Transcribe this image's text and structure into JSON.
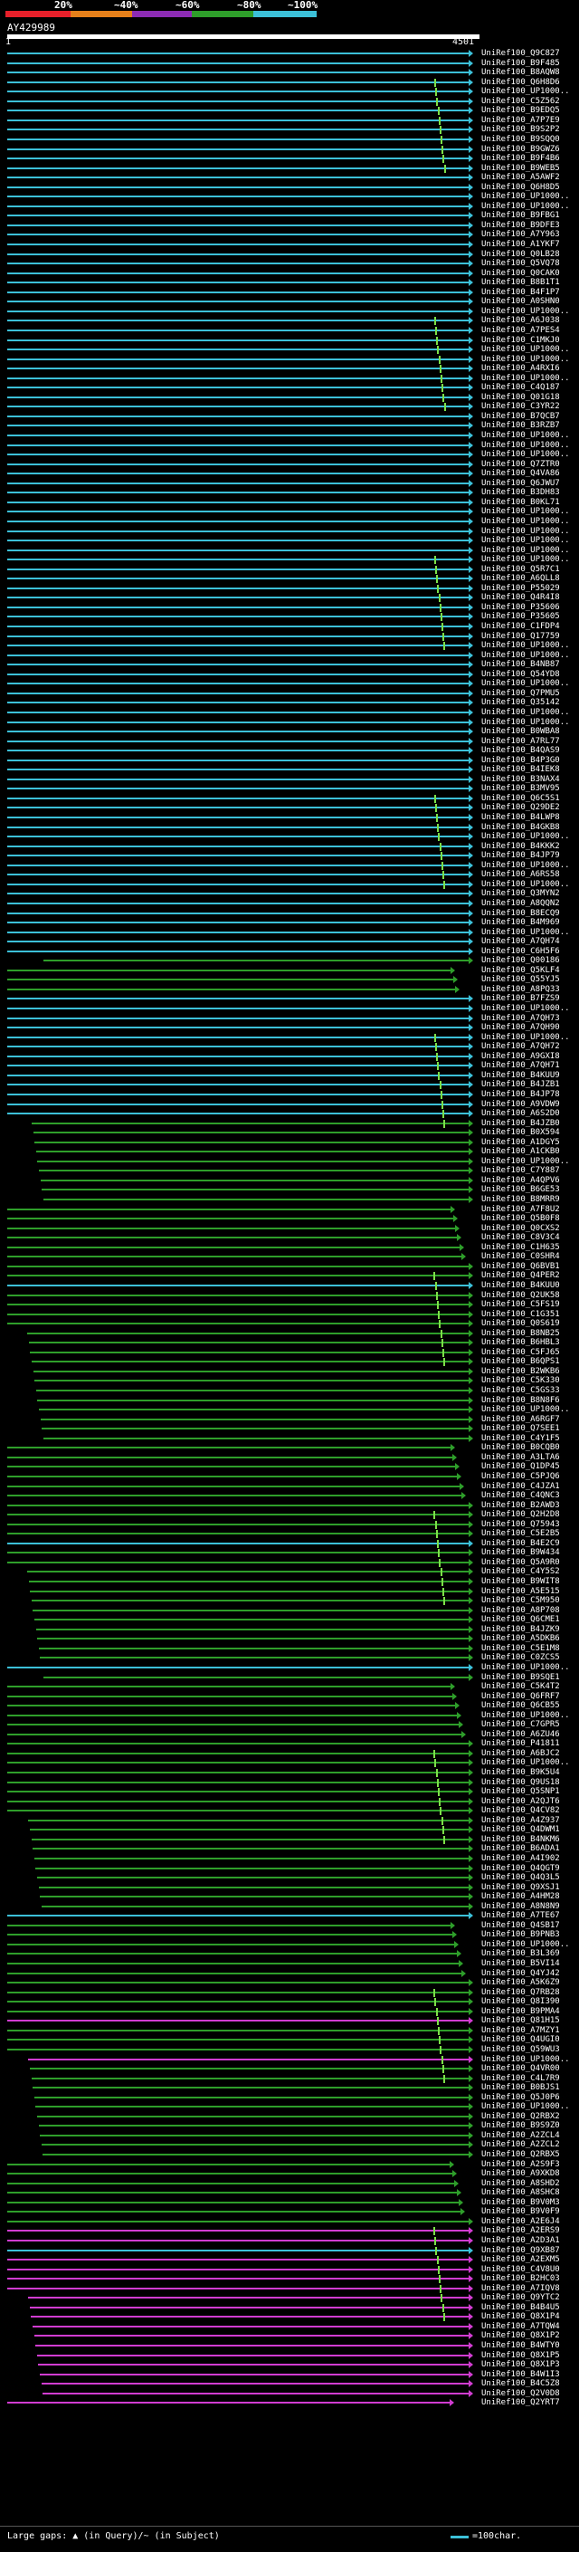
{
  "colors": {
    "bg": "#000000",
    "red": "#e8202a",
    "orange": "#e6801a",
    "purple": "#8c2bb4",
    "green": "#2e9e2a",
    "cyan": "#3cc0d8",
    "magenta": "#d03cd0",
    "lightgreen": "#7ce048",
    "white": "#ffffff"
  },
  "header": {
    "labels": [
      {
        "text": "20%"
      },
      {
        "text": "~40%"
      },
      {
        "text": "~60%"
      },
      {
        "text": "~80%"
      },
      {
        "text": "~100%"
      }
    ]
  },
  "query": {
    "name": "AY429989",
    "start": "1",
    "end": "4501"
  },
  "hits": [
    {
      "id": "UniRef100_Q9C827",
      "c": "cyan"
    },
    {
      "id": "UniRef100_B9F485",
      "c": "cyan"
    },
    {
      "id": "UniRef100_B8AQW8",
      "c": "cyan"
    },
    {
      "id": "UniRef100_Q6H8D6",
      "c": "cyan"
    },
    {
      "id": "UniRef100_UP1000..",
      "c": "cyan"
    },
    {
      "id": "UniRef100_C5Z562",
      "c": "cyan"
    },
    {
      "id": "UniRef100_B9EDQ5",
      "c": "cyan"
    },
    {
      "id": "UniRef100_A7P7E9",
      "c": "cyan"
    },
    {
      "id": "UniRef100_B9S2P2",
      "c": "cyan"
    },
    {
      "id": "UniRef100_B9SQQ0",
      "c": "cyan"
    },
    {
      "id": "UniRef100_B9GWZ6",
      "c": "cyan"
    },
    {
      "id": "UniRef100_B9F4B6",
      "c": "cyan"
    },
    {
      "id": "UniRef100_B9WEB5",
      "c": "cyan"
    },
    {
      "id": "UniRef100_A5AWF2",
      "c": "cyan"
    },
    {
      "id": "UniRef100_Q6H8D5",
      "c": "cyan"
    },
    {
      "id": "UniRef100_UP1000..",
      "c": "cyan"
    },
    {
      "id": "UniRef100_UP1000..",
      "c": "cyan"
    },
    {
      "id": "UniRef100_B9FBG1",
      "c": "cyan"
    },
    {
      "id": "UniRef100_B9DFE3",
      "c": "cyan"
    },
    {
      "id": "UniRef100_A7Y963",
      "c": "cyan"
    },
    {
      "id": "UniRef100_A1YKF7",
      "c": "cyan"
    },
    {
      "id": "UniRef100_Q0LB28",
      "c": "cyan"
    },
    {
      "id": "UniRef100_Q5VQ78",
      "c": "cyan"
    },
    {
      "id": "UniRef100_Q0CAK0",
      "c": "cyan"
    },
    {
      "id": "UniRef100_B8B1T1",
      "c": "cyan"
    },
    {
      "id": "UniRef100_B4F1P7",
      "c": "cyan"
    },
    {
      "id": "UniRef100_A0SHN0",
      "c": "cyan"
    },
    {
      "id": "UniRef100_UP1000..",
      "c": "cyan"
    },
    {
      "id": "UniRef100_A6J038",
      "c": "cyan"
    },
    {
      "id": "UniRef100_A7PES4",
      "c": "cyan"
    },
    {
      "id": "UniRef100_C1MKJ0",
      "c": "cyan"
    },
    {
      "id": "UniRef100_UP1000..",
      "c": "cyan"
    },
    {
      "id": "UniRef100_UP1000..",
      "c": "cyan"
    },
    {
      "id": "UniRef100_A4RXI6",
      "c": "cyan"
    },
    {
      "id": "UniRef100_UP1000..",
      "c": "cyan"
    },
    {
      "id": "UniRef100_C4Q187",
      "c": "cyan"
    },
    {
      "id": "UniRef100_Q01G18",
      "c": "cyan"
    },
    {
      "id": "UniRef100_C3YR22",
      "c": "cyan"
    },
    {
      "id": "UniRef100_B7QCB7",
      "c": "cyan"
    },
    {
      "id": "UniRef100_B3RZB7",
      "c": "cyan"
    },
    {
      "id": "UniRef100_UP1000..",
      "c": "cyan"
    },
    {
      "id": "UniRef100_UP1000..",
      "c": "cyan"
    },
    {
      "id": "UniRef100_UP1000..",
      "c": "cyan"
    },
    {
      "id": "UniRef100_Q7ZTR0",
      "c": "cyan"
    },
    {
      "id": "UniRef100_Q4VA86",
      "c": "cyan"
    },
    {
      "id": "UniRef100_Q6JWU7",
      "c": "cyan"
    },
    {
      "id": "UniRef100_B3DH83",
      "c": "cyan"
    },
    {
      "id": "UniRef100_B0KL71",
      "c": "cyan"
    },
    {
      "id": "UniRef100_UP1000..",
      "c": "cyan"
    },
    {
      "id": "UniRef100_UP1000..",
      "c": "cyan"
    },
    {
      "id": "UniRef100_UP1000..",
      "c": "cyan"
    },
    {
      "id": "UniRef100_UP1000..",
      "c": "cyan"
    },
    {
      "id": "UniRef100_UP1000..",
      "c": "cyan"
    },
    {
      "id": "UniRef100_UP1000..",
      "c": "cyan"
    },
    {
      "id": "UniRef100_Q5R7C1",
      "c": "cyan"
    },
    {
      "id": "UniRef100_A6QLL8",
      "c": "cyan"
    },
    {
      "id": "UniRef100_P55029",
      "c": "cyan"
    },
    {
      "id": "UniRef100_Q4R4I8",
      "c": "cyan"
    },
    {
      "id": "UniRef100_P35606",
      "c": "cyan"
    },
    {
      "id": "UniRef100_P35605",
      "c": "cyan"
    },
    {
      "id": "UniRef100_C1FDP4",
      "c": "cyan"
    },
    {
      "id": "UniRef100_Q17759",
      "c": "cyan"
    },
    {
      "id": "UniRef100_UP1000..",
      "c": "cyan"
    },
    {
      "id": "UniRef100_UP1000..",
      "c": "cyan"
    },
    {
      "id": "UniRef100_B4NB87",
      "c": "cyan"
    },
    {
      "id": "UniRef100_Q54YD8",
      "c": "cyan"
    },
    {
      "id": "UniRef100_UP1000..",
      "c": "cyan"
    },
    {
      "id": "UniRef100_Q7PMU5",
      "c": "cyan"
    },
    {
      "id": "UniRef100_Q35142",
      "c": "cyan"
    },
    {
      "id": "UniRef100_UP1000..",
      "c": "cyan"
    },
    {
      "id": "UniRef100_UP1000..",
      "c": "cyan"
    },
    {
      "id": "UniRef100_B0WBA8",
      "c": "cyan"
    },
    {
      "id": "UniRef100_A7RL77",
      "c": "cyan"
    },
    {
      "id": "UniRef100_B4QAS9",
      "c": "cyan"
    },
    {
      "id": "UniRef100_B4P3G0",
      "c": "cyan"
    },
    {
      "id": "UniRef100_B4IEK8",
      "c": "cyan"
    },
    {
      "id": "UniRef100_B3NAX4",
      "c": "cyan"
    },
    {
      "id": "UniRef100_B3MV95",
      "c": "cyan"
    },
    {
      "id": "UniRef100_Q6C5S1",
      "c": "cyan"
    },
    {
      "id": "UniRef100_Q29DE2",
      "c": "cyan"
    },
    {
      "id": "UniRef100_B4LWP8",
      "c": "cyan"
    },
    {
      "id": "UniRef100_B4GKB8",
      "c": "cyan"
    },
    {
      "id": "UniRef100_UP1000..",
      "c": "cyan"
    },
    {
      "id": "UniRef100_B4KKK2",
      "c": "cyan"
    },
    {
      "id": "UniRef100_B4JP79",
      "c": "cyan"
    },
    {
      "id": "UniRef100_UP1000..",
      "c": "cyan"
    },
    {
      "id": "UniRef100_A6RS58",
      "c": "cyan"
    },
    {
      "id": "UniRef100_UP1000..",
      "c": "cyan"
    },
    {
      "id": "UniRef100_Q3MYN2",
      "c": "cyan"
    },
    {
      "id": "UniRef100_A8QQN2",
      "c": "cyan"
    },
    {
      "id": "UniRef100_B8ECQ9",
      "c": "cyan"
    },
    {
      "id": "UniRef100_B4M969",
      "c": "cyan"
    },
    {
      "id": "UniRef100_UP1000..",
      "c": "cyan"
    },
    {
      "id": "UniRef100_A7QH74",
      "c": "cyan"
    },
    {
      "id": "UniRef100_C6H5F6",
      "c": "cyan"
    },
    {
      "id": "UniRef100_Q00186",
      "c": "green"
    },
    {
      "id": "UniRef100_Q5KLF4",
      "c": "green"
    },
    {
      "id": "UniRef100_Q55YJ5",
      "c": "green"
    },
    {
      "id": "UniRef100_A8PQ33",
      "c": "green"
    },
    {
      "id": "UniRef100_B7FZS9",
      "c": "cyan"
    },
    {
      "id": "UniRef100_UP1000..",
      "c": "cyan"
    },
    {
      "id": "UniRef100_A7QH73",
      "c": "cyan"
    },
    {
      "id": "UniRef100_A7QH90",
      "c": "cyan"
    },
    {
      "id": "UniRef100_UP1000..",
      "c": "cyan"
    },
    {
      "id": "UniRef100_A7QH72",
      "c": "cyan"
    },
    {
      "id": "UniRef100_A9GXI8",
      "c": "cyan"
    },
    {
      "id": "UniRef100_A7QH71",
      "c": "cyan"
    },
    {
      "id": "UniRef100_B4KUU9",
      "c": "cyan"
    },
    {
      "id": "UniRef100_B4JZB1",
      "c": "cyan"
    },
    {
      "id": "UniRef100_B4JP78",
      "c": "cyan"
    },
    {
      "id": "UniRef100_A9VDW9",
      "c": "cyan"
    },
    {
      "id": "UniRef100_A6S2D0",
      "c": "cyan"
    },
    {
      "id": "UniRef100_B4JZB0",
      "c": "green"
    },
    {
      "id": "UniRef100_B0X594",
      "c": "green"
    },
    {
      "id": "UniRef100_A1DGY5",
      "c": "green"
    },
    {
      "id": "UniRef100_A1CKB0",
      "c": "green"
    },
    {
      "id": "UniRef100_UP1000..",
      "c": "green"
    },
    {
      "id": "UniRef100_C7Y887",
      "c": "green"
    },
    {
      "id": "UniRef100_A4QPV6",
      "c": "green"
    },
    {
      "id": "UniRef100_B6GE53",
      "c": "green"
    },
    {
      "id": "UniRef100_B8MRR9",
      "c": "green"
    },
    {
      "id": "UniRef100_A7F8U2",
      "c": "green"
    },
    {
      "id": "UniRef100_Q5B0F8",
      "c": "green"
    },
    {
      "id": "UniRef100_Q0CXS2",
      "c": "green"
    },
    {
      "id": "UniRef100_C8V3C4",
      "c": "green"
    },
    {
      "id": "UniRef100_C1H635",
      "c": "green"
    },
    {
      "id": "UniRef100_C0SHR4",
      "c": "green"
    },
    {
      "id": "UniRef100_Q6BVB1",
      "c": "green"
    },
    {
      "id": "UniRef100_Q4PER2",
      "c": "green"
    },
    {
      "id": "UniRef100_B4KUU0",
      "c": "cyan"
    },
    {
      "id": "UniRef100_Q2UK58",
      "c": "green"
    },
    {
      "id": "UniRef100_C5FS19",
      "c": "green"
    },
    {
      "id": "UniRef100_C1G351",
      "c": "green"
    },
    {
      "id": "UniRef100_Q0S619",
      "c": "green"
    },
    {
      "id": "UniRef100_B8NB25",
      "c": "green"
    },
    {
      "id": "UniRef100_B6HBL3",
      "c": "green"
    },
    {
      "id": "UniRef100_C5FJ65",
      "c": "green"
    },
    {
      "id": "UniRef100_B6QPS1",
      "c": "green"
    },
    {
      "id": "UniRef100_B2WKB6",
      "c": "green"
    },
    {
      "id": "UniRef100_C5K330",
      "c": "green"
    },
    {
      "id": "UniRef100_C5GS33",
      "c": "green"
    },
    {
      "id": "UniRef100_B8N8F6",
      "c": "green"
    },
    {
      "id": "UniRef100_UP1000..",
      "c": "green"
    },
    {
      "id": "UniRef100_A6RGF7",
      "c": "green"
    },
    {
      "id": "UniRef100_Q7SEE1",
      "c": "green"
    },
    {
      "id": "UniRef100_C4Y1F5",
      "c": "green"
    },
    {
      "id": "UniRef100_B0CQB0",
      "c": "green"
    },
    {
      "id": "UniRef100_A3LTA6",
      "c": "green"
    },
    {
      "id": "UniRef100_Q1DP45",
      "c": "green"
    },
    {
      "id": "UniRef100_C5PJQ6",
      "c": "green"
    },
    {
      "id": "UniRef100_C4JZA1",
      "c": "green"
    },
    {
      "id": "UniRef100_C4QNC3",
      "c": "green"
    },
    {
      "id": "UniRef100_B2AWD3",
      "c": "green"
    },
    {
      "id": "UniRef100_Q2H2D8",
      "c": "green"
    },
    {
      "id": "UniRef100_Q75943",
      "c": "green"
    },
    {
      "id": "UniRef100_C5E2B5",
      "c": "green"
    },
    {
      "id": "UniRef100_B4E2C9",
      "c": "cyan"
    },
    {
      "id": "UniRef100_B9W434",
      "c": "green"
    },
    {
      "id": "UniRef100_Q5A9R0",
      "c": "green"
    },
    {
      "id": "UniRef100_C4Y5S2",
      "c": "green"
    },
    {
      "id": "UniRef100_B9WIT8",
      "c": "green"
    },
    {
      "id": "UniRef100_A5E515",
      "c": "green"
    },
    {
      "id": "UniRef100_C5M950",
      "c": "green"
    },
    {
      "id": "UniRef100_A8P708",
      "c": "green"
    },
    {
      "id": "UniRef100_Q6CME1",
      "c": "green"
    },
    {
      "id": "UniRef100_B4JZK9",
      "c": "green"
    },
    {
      "id": "UniRef100_A5DKB6",
      "c": "green"
    },
    {
      "id": "UniRef100_C5E1M8",
      "c": "green"
    },
    {
      "id": "UniRef100_C0ZCS5",
      "c": "green"
    },
    {
      "id": "UniRef100_UP1000..",
      "c": "cyan"
    },
    {
      "id": "UniRef100_B9SQE1",
      "c": "green"
    },
    {
      "id": "UniRef100_C5K4T2",
      "c": "green"
    },
    {
      "id": "UniRef100_Q6FRF7",
      "c": "green"
    },
    {
      "id": "UniRef100_Q6CB55",
      "c": "green"
    },
    {
      "id": "UniRef100_UP1000..",
      "c": "green"
    },
    {
      "id": "UniRef100_C7GPR5",
      "c": "green"
    },
    {
      "id": "UniRef100_A6ZU46",
      "c": "green"
    },
    {
      "id": "UniRef100_P41811",
      "c": "green"
    },
    {
      "id": "UniRef100_A6BJC2",
      "c": "green"
    },
    {
      "id": "UniRef100_UP1000..",
      "c": "green"
    },
    {
      "id": "UniRef100_B9K5U4",
      "c": "green"
    },
    {
      "id": "UniRef100_Q9US18",
      "c": "green"
    },
    {
      "id": "UniRef100_Q5SNP1",
      "c": "green"
    },
    {
      "id": "UniRef100_A2QJT6",
      "c": "green"
    },
    {
      "id": "UniRef100_Q4CV82",
      "c": "green"
    },
    {
      "id": "UniRef100_A4Z937",
      "c": "green"
    },
    {
      "id": "UniRef100_Q4DWM1",
      "c": "green"
    },
    {
      "id": "UniRef100_B4NKM6",
      "c": "green"
    },
    {
      "id": "UniRef100_B6ADA1",
      "c": "green"
    },
    {
      "id": "UniRef100_A4I902",
      "c": "green"
    },
    {
      "id": "UniRef100_Q4QGT9",
      "c": "green"
    },
    {
      "id": "UniRef100_Q4Q3L5",
      "c": "green"
    },
    {
      "id": "UniRef100_Q9XSJ1",
      "c": "green"
    },
    {
      "id": "UniRef100_A4HM28",
      "c": "green"
    },
    {
      "id": "UniRef100_A8N8N9",
      "c": "green"
    },
    {
      "id": "UniRef100_A7TE67",
      "c": "cyan"
    },
    {
      "id": "UniRef100_Q4SB17",
      "c": "green"
    },
    {
      "id": "UniRef100_B9PNB3",
      "c": "green"
    },
    {
      "id": "UniRef100_UP1000..",
      "c": "green"
    },
    {
      "id": "UniRef100_B3L369",
      "c": "green"
    },
    {
      "id": "UniRef100_B5VI14",
      "c": "green"
    },
    {
      "id": "UniRef100_Q4YJ42",
      "c": "green"
    },
    {
      "id": "UniRef100_A5K6Z9",
      "c": "green"
    },
    {
      "id": "UniRef100_Q7RB28",
      "c": "green"
    },
    {
      "id": "UniRef100_Q8I390",
      "c": "green"
    },
    {
      "id": "UniRef100_B9PMA4",
      "c": "green"
    },
    {
      "id": "UniRef100_Q81H15",
      "c": "magenta"
    },
    {
      "id": "UniRef100_A7MZY1",
      "c": "green"
    },
    {
      "id": "UniRef100_Q4UGI0",
      "c": "green"
    },
    {
      "id": "UniRef100_Q59WU3",
      "c": "green"
    },
    {
      "id": "UniRef100_UP1000..",
      "c": "magenta"
    },
    {
      "id": "UniRef100_Q4VR00",
      "c": "green"
    },
    {
      "id": "UniRef100_C4L7R9",
      "c": "green"
    },
    {
      "id": "UniRef100_B0BJS1",
      "c": "green"
    },
    {
      "id": "UniRef100_Q5J0P6",
      "c": "green"
    },
    {
      "id": "UniRef100_UP1000..",
      "c": "green"
    },
    {
      "id": "UniRef100_Q2RBX2",
      "c": "green"
    },
    {
      "id": "UniRef100_B9S9Z0",
      "c": "green"
    },
    {
      "id": "UniRef100_A2ZCL4",
      "c": "green"
    },
    {
      "id": "UniRef100_A2ZCL2",
      "c": "green"
    },
    {
      "id": "UniRef100_Q2RBX5",
      "c": "green"
    },
    {
      "id": "UniRef100_A2S9F3",
      "c": "green"
    },
    {
      "id": "UniRef100_A9XKD8",
      "c": "green"
    },
    {
      "id": "UniRef100_A8SHD2",
      "c": "green"
    },
    {
      "id": "UniRef100_A8SHC8",
      "c": "green"
    },
    {
      "id": "UniRef100_B9V0M3",
      "c": "green"
    },
    {
      "id": "UniRef100_B9V0F9",
      "c": "green"
    },
    {
      "id": "UniRef100_A2E6J4",
      "c": "green"
    },
    {
      "id": "UniRef100_A2ERS9",
      "c": "magenta"
    },
    {
      "id": "UniRef100_A2D3A1",
      "c": "magenta"
    },
    {
      "id": "UniRef100_Q9XB87",
      "c": "cyan"
    },
    {
      "id": "UniRef100_A2EXM5",
      "c": "magenta"
    },
    {
      "id": "UniRef100_C4V8U0",
      "c": "magenta"
    },
    {
      "id": "UniRef100_B2HC03",
      "c": "magenta"
    },
    {
      "id": "UniRef100_A7IQV8",
      "c": "magenta"
    },
    {
      "id": "UniRef100_Q9YTC2",
      "c": "magenta"
    },
    {
      "id": "UniRef100_B4B4U5",
      "c": "magenta"
    },
    {
      "id": "UniRef100_Q8X1P4",
      "c": "magenta"
    },
    {
      "id": "UniRef100_A7TQW4",
      "c": "magenta"
    },
    {
      "id": "UniRef100_Q8X1P2",
      "c": "magenta"
    },
    {
      "id": "UniRef100_B4WTY0",
      "c": "magenta"
    },
    {
      "id": "UniRef100_Q8X1P5",
      "c": "magenta"
    },
    {
      "id": "UniRef100_Q8X1P3",
      "c": "magenta"
    },
    {
      "id": "UniRef100_B4W1I3",
      "c": "magenta"
    },
    {
      "id": "UniRef100_B4C5Z8",
      "c": "magenta"
    },
    {
      "id": "UniRef100_Q2V0D8",
      "c": "magenta"
    },
    {
      "id": "UniRef100_Q2YRT7",
      "c": "magenta"
    }
  ],
  "footer": {
    "gaps_text": "Large gaps: ▲ (in Query)/~ (in Subject)",
    "scale_text": "=100char."
  }
}
